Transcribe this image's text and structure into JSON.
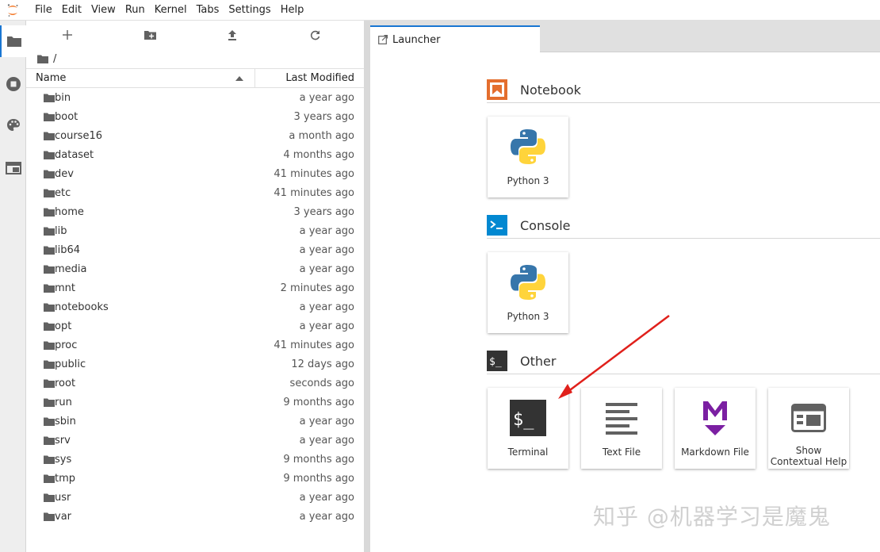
{
  "menu": [
    "File",
    "Edit",
    "View",
    "Run",
    "Kernel",
    "Tabs",
    "Settings",
    "Help"
  ],
  "breadcrumb": "/",
  "filebrowser": {
    "columns": {
      "name": "Name",
      "modified": "Last Modified"
    },
    "rows": [
      {
        "name": "bin",
        "modified": "a year ago"
      },
      {
        "name": "boot",
        "modified": "3 years ago"
      },
      {
        "name": "course16",
        "modified": "a month ago"
      },
      {
        "name": "dataset",
        "modified": "4 months ago"
      },
      {
        "name": "dev",
        "modified": "41 minutes ago"
      },
      {
        "name": "etc",
        "modified": "41 minutes ago"
      },
      {
        "name": "home",
        "modified": "3 years ago"
      },
      {
        "name": "lib",
        "modified": "a year ago"
      },
      {
        "name": "lib64",
        "modified": "a year ago"
      },
      {
        "name": "media",
        "modified": "a year ago"
      },
      {
        "name": "mnt",
        "modified": "2 minutes ago"
      },
      {
        "name": "notebooks",
        "modified": "a year ago"
      },
      {
        "name": "opt",
        "modified": "a year ago"
      },
      {
        "name": "proc",
        "modified": "41 minutes ago"
      },
      {
        "name": "public",
        "modified": "12 days ago"
      },
      {
        "name": "root",
        "modified": "seconds ago"
      },
      {
        "name": "run",
        "modified": "9 months ago"
      },
      {
        "name": "sbin",
        "modified": "a year ago"
      },
      {
        "name": "srv",
        "modified": "a year ago"
      },
      {
        "name": "sys",
        "modified": "9 months ago"
      },
      {
        "name": "tmp",
        "modified": "9 months ago"
      },
      {
        "name": "usr",
        "modified": "a year ago"
      },
      {
        "name": "var",
        "modified": "a year ago"
      }
    ]
  },
  "tab": {
    "label": "Launcher"
  },
  "launcher": {
    "notebook": {
      "title": "Notebook",
      "items": [
        {
          "label": "Python 3"
        }
      ]
    },
    "console": {
      "title": "Console",
      "items": [
        {
          "label": "Python 3"
        }
      ]
    },
    "other": {
      "title": "Other",
      "items": [
        {
          "label": "Terminal"
        },
        {
          "label": "Text File"
        },
        {
          "label": "Markdown File"
        },
        {
          "label": "Show Contextual Help"
        }
      ]
    }
  },
  "watermark": "知乎 @机器学习是魔鬼",
  "colors": {
    "accent": "#1976d2",
    "notebook_icon": "#e46e2e",
    "console_icon": "#0288d1",
    "markdown_icon": "#7b1fa2",
    "arrow": "#e0201b",
    "folder": "#616161"
  },
  "icons": {
    "new-launcher": "plus-icon",
    "new-folder": "new-folder-icon",
    "upload": "upload-icon",
    "refresh": "refresh-icon"
  }
}
